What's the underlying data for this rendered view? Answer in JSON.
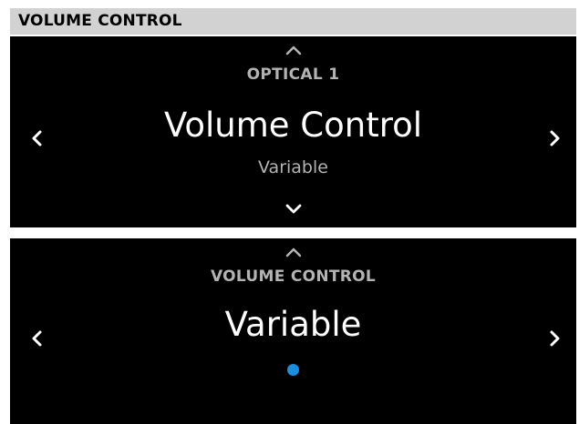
{
  "header": {
    "title": "VOLUME CONTROL"
  },
  "screen1": {
    "source_label": "OPTICAL 1",
    "setting_title": "Volume Control",
    "setting_value": "Variable"
  },
  "screen2": {
    "section_label": "VOLUME CONTROL",
    "selected_value": "Variable"
  },
  "colors": {
    "header_bg": "#d2d2d2",
    "panel_bg": "#000000",
    "secondary_text": "#b3b3b3",
    "primary_text": "#ffffff",
    "indicator_dot": "#1a8fe0"
  },
  "icons": [
    "chevron-up-icon",
    "chevron-down-icon",
    "chevron-left-icon",
    "chevron-right-icon",
    "indicator-dot-icon"
  ]
}
